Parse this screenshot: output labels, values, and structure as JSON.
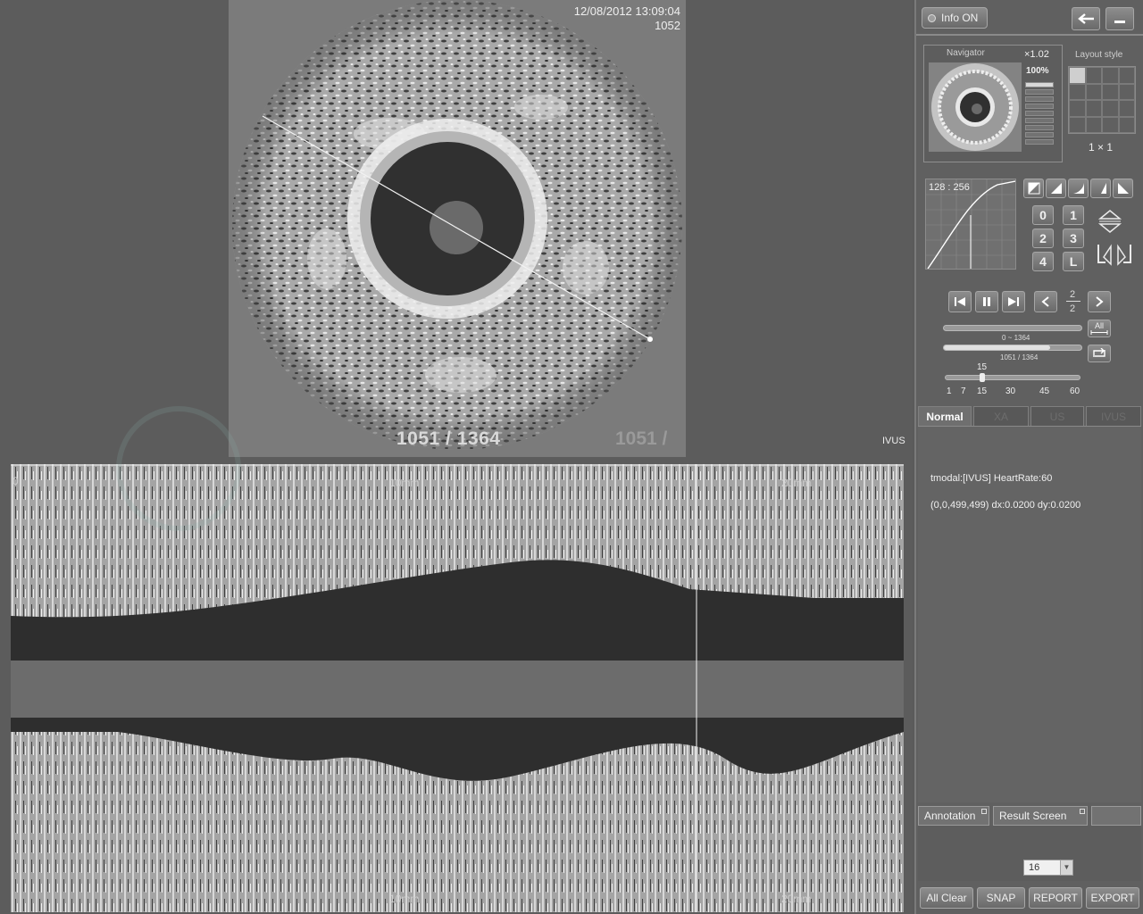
{
  "viewer": {
    "datetime": "12/08/2012 13:09:04",
    "frame_id": "1052",
    "frame_counter": "1051 / 1364",
    "frame_counter_ghost": "1051 /",
    "mode_label": "IVUS",
    "long_ticks_top": [
      "0",
      "10mm",
      "20mm"
    ],
    "long_ticks_bottom": [
      "10mm",
      "20mm"
    ]
  },
  "panel": {
    "info_button": "Info ON",
    "back_icon": "back-arrow-icon",
    "minimize_icon": "minimize-icon",
    "navigator": {
      "title": "Navigator",
      "zoom_factor": "×1.02",
      "zoom_percent": "100%",
      "zoom_level": 1
    },
    "layout": {
      "title": "Layout style",
      "value": "1 × 1"
    },
    "lut": {
      "label": "128 : 256",
      "number_buttons": [
        "0",
        "1",
        "2",
        "3",
        "4",
        "L"
      ]
    },
    "playback": {
      "page_top": "2",
      "page_bottom": "2",
      "range_label": "0 ~ 1364",
      "position_label": "1051 / 1364",
      "position_fraction": 0.77,
      "all_button": "All",
      "speed_value": "15",
      "speed_ticks": [
        "1",
        "7",
        "15",
        "30",
        "45",
        "60"
      ]
    },
    "tabs": [
      {
        "label": "Normal",
        "active": true
      },
      {
        "label": "XA",
        "active": false
      },
      {
        "label": "US",
        "active": false
      },
      {
        "label": "IVUS",
        "active": false
      }
    ],
    "info_lines": [
      "tmodal:[IVUS] HeartRate:60",
      "(0,0,499,499) dx:0.0200 dy:0.0200"
    ],
    "bottom_tabs": [
      "Annotation",
      "Result Screen"
    ],
    "select_value": "16",
    "actions": [
      "All Clear",
      "SNAP",
      "REPORT",
      "EXPORT"
    ]
  }
}
